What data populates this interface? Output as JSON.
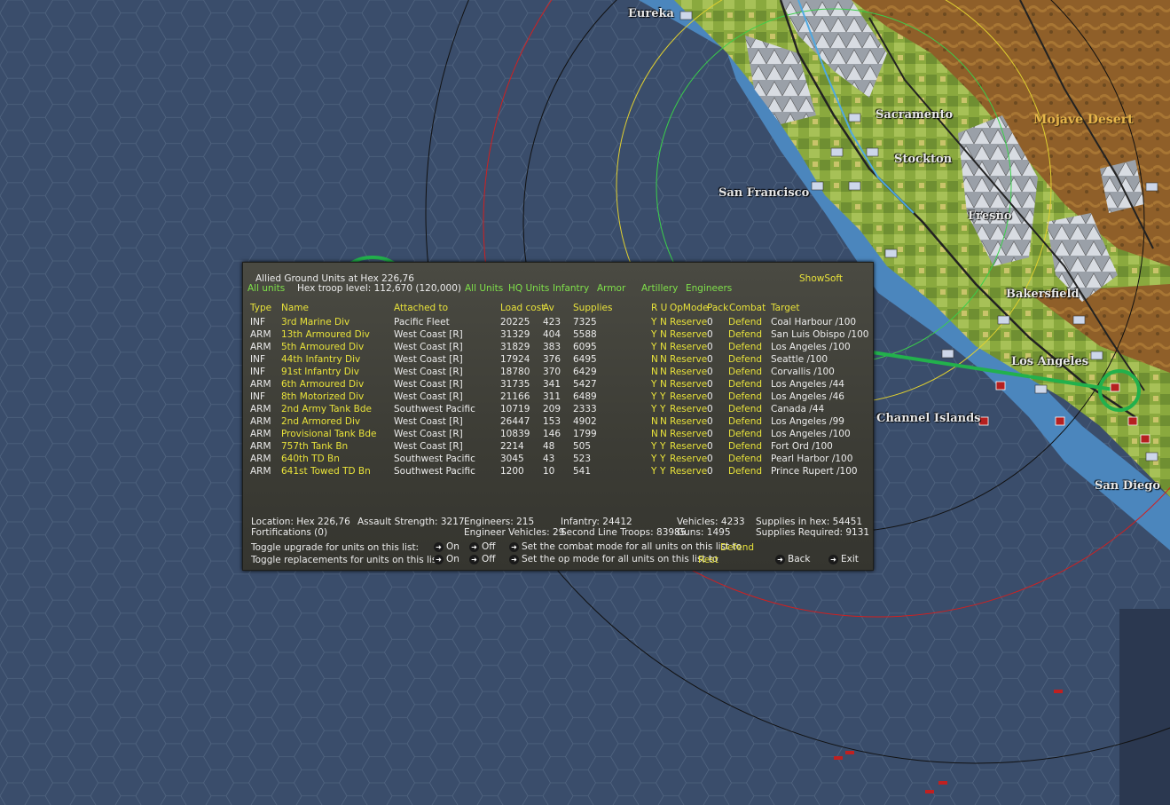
{
  "map": {
    "cities": [
      {
        "name": "Eureka"
      },
      {
        "name": "Sacramento"
      },
      {
        "name": "Stockton"
      },
      {
        "name": "San Francisco"
      },
      {
        "name": "Fresno"
      },
      {
        "name": "Mojave Desert"
      },
      {
        "name": "Bakersfield"
      },
      {
        "name": "Los Angeles"
      },
      {
        "name": "Channel Islands"
      },
      {
        "name": "San Diego"
      }
    ],
    "colors": {
      "ocean": "#3a4d6b",
      "coast_water": "#4f8cc4",
      "land_green": "#9ab84a",
      "desert": "#9c6a2e",
      "route": "#22b14c"
    }
  },
  "panel": {
    "title": "Allied Ground Units at Hex 226,76",
    "hex_troop_level": "Hex troop level: 112,670  (120,000)",
    "show_soft": "ShowSoft",
    "filters": [
      "All units",
      "All Units",
      "HQ Units",
      "Infantry",
      "Armor",
      "Artillery",
      "Engineers"
    ],
    "columns": {
      "type": "Type",
      "name": "Name",
      "attached": "Attached to",
      "load": "Load cost",
      "av": "Av",
      "supplies": "Supplies",
      "ru": "R U",
      "opmode": "OpMode",
      "pack": "Pack",
      "combat": "Combat",
      "target": "Target"
    },
    "units": [
      {
        "type": "INF",
        "name": "3rd Marine Div",
        "attached": "Pacific Fleet",
        "load": "20225",
        "av": "423",
        "supplies": "7325",
        "r": "Y",
        "u": "N",
        "opmode": "Reserve",
        "pack": "0",
        "combat": "Defend",
        "target": "Coal Harbour /100"
      },
      {
        "type": "ARM",
        "name": "13th Armoured Div",
        "attached": "West Coast [R]",
        "load": "31329",
        "av": "404",
        "supplies": "5588",
        "r": "Y",
        "u": "N",
        "opmode": "Reserve",
        "pack": "0",
        "combat": "Defend",
        "target": "San Luis Obispo /100"
      },
      {
        "type": "ARM",
        "name": "5th Armoured Div",
        "attached": "West Coast [R]",
        "load": "31829",
        "av": "383",
        "supplies": "6095",
        "r": "Y",
        "u": "N",
        "opmode": "Reserve",
        "pack": "0",
        "combat": "Defend",
        "target": "Los Angeles /100"
      },
      {
        "type": "INF",
        "name": "44th Infantry Div",
        "attached": "West Coast [R]",
        "load": "17924",
        "av": "376",
        "supplies": "6495",
        "r": "N",
        "u": "N",
        "opmode": "Reserve",
        "pack": "0",
        "combat": "Defend",
        "target": "Seattle /100"
      },
      {
        "type": "INF",
        "name": "91st Infantry Div",
        "attached": "West Coast [R]",
        "load": "18780",
        "av": "370",
        "supplies": "6429",
        "r": "N",
        "u": "N",
        "opmode": "Reserve",
        "pack": "0",
        "combat": "Defend",
        "target": "Corvallis /100"
      },
      {
        "type": "ARM",
        "name": "6th Armoured Div",
        "attached": "West Coast [R]",
        "load": "31735",
        "av": "341",
        "supplies": "5427",
        "r": "Y",
        "u": "N",
        "opmode": "Reserve",
        "pack": "0",
        "combat": "Defend",
        "target": "Los Angeles /44"
      },
      {
        "type": "INF",
        "name": "8th Motorized Div",
        "attached": "West Coast [R]",
        "load": "21166",
        "av": "311",
        "supplies": "6489",
        "r": "Y",
        "u": "Y",
        "opmode": "Reserve",
        "pack": "0",
        "combat": "Defend",
        "target": "Los Angeles /46"
      },
      {
        "type": "ARM",
        "name": "2nd Army Tank Bde",
        "attached": "Southwest Pacific",
        "load": "10719",
        "av": "209",
        "supplies": "2333",
        "r": "Y",
        "u": "Y",
        "opmode": "Reserve",
        "pack": "0",
        "combat": "Defend",
        "target": "Canada /44"
      },
      {
        "type": "ARM",
        "name": "2nd Armored Div",
        "attached": "West Coast [R]",
        "load": "26447",
        "av": "153",
        "supplies": "4902",
        "r": "N",
        "u": "N",
        "opmode": "Reserve",
        "pack": "0",
        "combat": "Defend",
        "target": "Los Angeles /99"
      },
      {
        "type": "ARM",
        "name": "Provisional Tank Bde",
        "attached": "West Coast [R]",
        "load": "10839",
        "av": "146",
        "supplies": "1799",
        "r": "N",
        "u": "N",
        "opmode": "Reserve",
        "pack": "0",
        "combat": "Defend",
        "target": "Los Angeles /100"
      },
      {
        "type": "ARM",
        "name": "757th Tank Bn",
        "attached": "West Coast [R]",
        "load": "2214",
        "av": "48",
        "supplies": "505",
        "r": "Y",
        "u": "Y",
        "opmode": "Reserve",
        "pack": "0",
        "combat": "Defend",
        "target": "Fort Ord /100"
      },
      {
        "type": "ARM",
        "name": "640th TD Bn",
        "attached": "Southwest Pacific",
        "load": "3045",
        "av": "43",
        "supplies": "523",
        "r": "Y",
        "u": "Y",
        "opmode": "Reserve",
        "pack": "0",
        "combat": "Defend",
        "target": "Pearl Harbor /100"
      },
      {
        "type": "ARM",
        "name": "641st Towed TD Bn",
        "attached": "Southwest Pacific",
        "load": "1200",
        "av": "10",
        "supplies": "541",
        "r": "Y",
        "u": "Y",
        "opmode": "Reserve",
        "pack": "0",
        "combat": "Defend",
        "target": "Prince Rupert /100"
      }
    ],
    "summary": {
      "location": "Location: Hex 226,76",
      "fortifications": "Fortifications (0)",
      "assault": "Assault Strength: 3217",
      "engineers": "Engineers:  215",
      "engineer_vehicles": "Engineer Vehicles:  29",
      "infantry": "Infantry: 24412",
      "second_line": "Second Line Troops: 83985",
      "vehicles": "Vehicles: 4233",
      "guns": "Guns: 1495",
      "supplies_in_hex": "Supplies in hex:  54451",
      "supplies_required": "Supplies Required:  9131"
    },
    "toggles": {
      "upgrade_label": "Toggle upgrade for units on this list:",
      "replacements_label": "Toggle replacements for units on this list:",
      "on": "On",
      "off": "Off",
      "combat_mode_label": "Set the combat mode for all units on this list to",
      "combat_mode_value": "Defend",
      "op_mode_label": "Set the op mode for all units on this list to",
      "op_mode_value": "Rest",
      "back": "Back",
      "exit": "Exit"
    }
  }
}
